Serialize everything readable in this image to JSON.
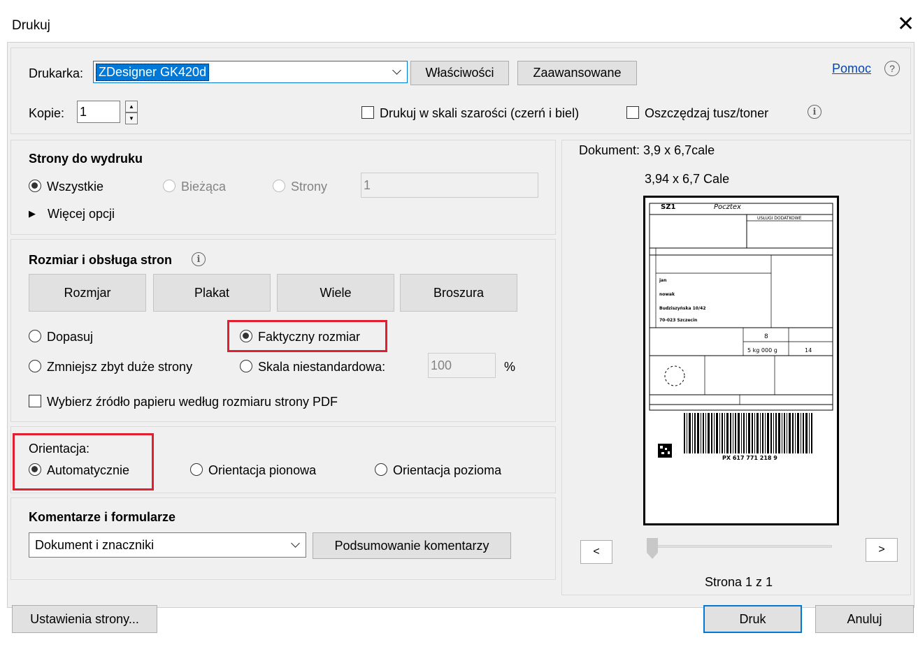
{
  "window": {
    "title": "Drukuj"
  },
  "printer": {
    "label": "Drukarka:",
    "selected": "ZDesigner GK420d",
    "properties_button": "Właściwości",
    "advanced_button": "Zaawansowane",
    "help_link": "Pomoc",
    "copies_label": "Kopie:",
    "copies_value": "1",
    "grayscale_label": "Drukuj w skali szarości (czerń i biel)",
    "save_ink_label": "Oszczędzaj tusz/toner"
  },
  "pages": {
    "heading": "Strony do wydruku",
    "all_label": "Wszystkie",
    "current_label": "Bieżąca",
    "pages_label": "Strony",
    "pages_value": "1",
    "more_options": "Więcej opcji"
  },
  "sizing": {
    "heading": "Rozmiar i obsługa stron",
    "buttons": [
      "Rozmjar",
      "Plakat",
      "Wiele",
      "Broszura"
    ],
    "fit_label": "Dopasuj",
    "actual_label": "Faktyczny rozmiar",
    "shrink_label": "Zmniejsz zbyt duże strony",
    "custom_label": "Skala niestandardowa:",
    "custom_value": "100",
    "percent": "%",
    "paper_source_label": "Wybierz źródło papieru według rozmiaru strony PDF"
  },
  "orientation": {
    "heading": "Orientacja:",
    "auto_label": "Automatycznie",
    "portrait_label": "Orientacja pionowa",
    "landscape_label": "Orientacja pozioma"
  },
  "comments": {
    "heading": "Komentarze i formularze",
    "selected": "Dokument i znaczniki",
    "summary_button": "Podsumowanie komentarzy"
  },
  "preview": {
    "document_size": "Dokument: 3,9 x 6,7cale",
    "page_size": "3,94 x 6,7 Cale",
    "prev": "<",
    "next": ">",
    "page_counter": "Strona 1 z 1",
    "label": {
      "code": "SZ1",
      "brand": "Pocztex",
      "service": "USŁUGI DODATKOWE",
      "recipient_line1": "jan",
      "recipient_line2": "nowak",
      "recipient_line3": "Budziszyńska 10/42",
      "recipient_line4": "70-023 Szczecin",
      "format": "8",
      "weight": "5 kg 000 g",
      "pieces": "14",
      "tracking": "PX 617 771 218 9"
    }
  },
  "footer": {
    "page_setup_button": "Ustawienia strony...",
    "print_button": "Druk",
    "cancel_button": "Anuluj"
  },
  "colors": {
    "accent": "#0078d7",
    "highlight_red": "#e0202e",
    "link": "#0645ad"
  }
}
